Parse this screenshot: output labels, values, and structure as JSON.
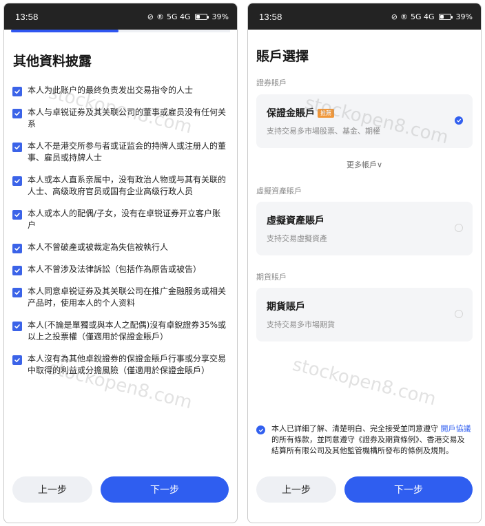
{
  "status_bar": {
    "time": "13:58",
    "battery_percent": "39",
    "battery_fill": 0.39,
    "network_label": "5G 4G"
  },
  "watermark": "stockopen8.com",
  "left_screen": {
    "progress": 0.49,
    "title": "其他資料披露",
    "items": [
      "本人为此账户的最终负责发出交易指令的人士",
      "本人与卓锐证券及其关联公司的董事或雇员没有任何关系",
      "本人不是港交所参与者或证监会的持牌人或注册人的董事、雇员或持牌人士",
      "本人或本人直系亲属中，没有政治人物或与其有关联的人士、高级政府官员或国有企业高级行政人员",
      "本人或本人的配偶/子女，没有在卓锐证券开立客户账户",
      "本人不曾破產或被裁定為失信被執行人",
      "本人不曾涉及法律訴訟（包括作為原告或被告）",
      "本人同意卓锐证券及其关联公司在推广金融服务或相关产品时，使用本人的个人资料",
      "本人(不論是單獨或與本人之配偶)沒有卓銳證券35%或以上之投票權（僅適用於保證金賬戶）",
      "本人沒有為其他卓銳證券的保證金賬戶行事或分享交易中取得的利益或分擔風險（僅適用於保證金賬戶）"
    ],
    "prev_label": "上一步",
    "next_label": "下一步"
  },
  "right_screen": {
    "title": "賬戶選擇",
    "securities": {
      "section_label": "證券賬戶",
      "card_title": "保證金賬戶",
      "tag": "推薦",
      "description": "支持交易多市場股票、基金、期權",
      "selected": true
    },
    "more_accounts": "更多帳戶",
    "virtual": {
      "section_label": "虛擬資產賬戶",
      "card_title": "虛擬資產賬戶",
      "description": "支持交易虛擬資產",
      "selected": false
    },
    "futures": {
      "section_label": "期貨賬戶",
      "card_title": "期貨賬戶",
      "description": "支持交易多市場期貨",
      "selected": false
    },
    "agreement": {
      "text_before": "本人已詳細了解、清楚明白、完全接受並同意遵守 ",
      "link": "開戶協議",
      "text_after": "的所有條款，並同意遵守《證券及期貨條例》、香港交易及結算所有限公司及其他監管機構所發布的條例及規則。"
    },
    "prev_label": "上一步",
    "next_label": "下一步"
  }
}
